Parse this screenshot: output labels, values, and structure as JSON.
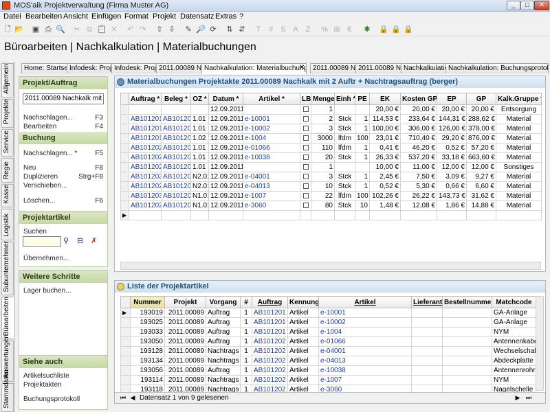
{
  "window": {
    "title": "MOS'aik Projektverwaltung (Firma Muster AG)",
    "minimize": "_",
    "maximize": "□",
    "close": "✕"
  },
  "menu": [
    "Datei",
    "Bearbeiten",
    "Ansicht",
    "Einfügen",
    "Format",
    "Projekt",
    "Datensatz",
    "Extras",
    "?"
  ],
  "toolbar_text": {
    "t": "T",
    "hash": "#",
    "s": "S",
    "a": "A",
    "z": "Z",
    "percent": "%"
  },
  "heading": "Büroarbeiten | Nachkalkulation | Materialbuchungen",
  "side_tabs": [
    "Allgemein",
    "Projekte",
    "Service",
    "Regie",
    "Kasse",
    "Logistik",
    "Subunternehmer",
    "Büroarbeiten",
    "Auswertungen",
    "Stammdaten"
  ],
  "doc_tabs": [
    "Home: Startseite",
    "Infodesk: Projekt",
    "Infodesk: Projekt",
    "2011.00089 Nachkalk",
    "Nachkalkulation: Materialbuchungen",
    "2011.00089 Nachk",
    "2011.00089 Nachk",
    "Nachkalkulation",
    "Nachkalkulation: Buchungsprotokoll"
  ],
  "left": {
    "projekt_head": "Projekt/Auftrag",
    "projekt_value": "2011.00089 Nachkalk mit 2 Au",
    "nachschlagen": "Nachschlagen...",
    "nachschlagen_key": "F3",
    "bearbeiten": "Bearbeiten",
    "bearbeiten_key": "F4",
    "buchung_head": "Buchung",
    "b_nachschlagen": "Nachschlagen... *",
    "b_nachschlagen_key": "F5",
    "neu": "Neu",
    "neu_key": "F8",
    "duplizieren": "Duplizieren",
    "duplizieren_key": "Strg+F8",
    "verschieben": "Verschieben...",
    "loeschen": "Löschen...",
    "loeschen_key": "F6",
    "artikel_head": "Projektartikel",
    "suchen": "Suchen",
    "uebernehmen": "Übernehmen...",
    "schritte_head": "Weitere Schritte",
    "lager": "Lager buchen...",
    "siehe_head": "Siehe auch",
    "artikelsuchliste": "Artikelsuchliste",
    "projektakten": "Projektakten",
    "buchungsprotokoll": "Buchungsprotokoll"
  },
  "buchungen": {
    "title": "Materialbuchungen Projektakte 2011.00089 Nachkalk mit 2 Auftr + Nachtragsauftrag (berger)",
    "columns": [
      "Auftrag *",
      "Beleg *",
      "OZ *",
      "Datum *",
      "Artikel *",
      "LB",
      "Menge",
      "Einh *",
      "PE",
      "EK",
      "Kosten GP",
      "EP",
      "GP",
      "Kalk.Gruppe *"
    ],
    "rows": [
      [
        "",
        "",
        "",
        "12.09.2011",
        "",
        "",
        "1",
        "",
        "",
        "20,00 €",
        "20,00 €",
        "20,00 €",
        "20,00 €",
        "Entsorgung"
      ],
      [
        "AB101201",
        "AB101201",
        "1.01",
        "12.09.2011",
        "e-10001",
        "",
        "2",
        "Stck",
        "1",
        "114,53 €",
        "233,64 €",
        "144,31 €",
        "288,62 €",
        "Material"
      ],
      [
        "AB101201",
        "AB101201",
        "1.01",
        "12.09.2011",
        "e-10002",
        "",
        "3",
        "Stck",
        "1",
        "100,00 €",
        "306,00 €",
        "126,00 €",
        "378,00 €",
        "Material"
      ],
      [
        "AB101201",
        "AB101201",
        "1.02",
        "12.09.2011",
        "e-1004",
        "",
        "3000",
        "lfdm",
        "100",
        "23,01 €",
        "710,40 €",
        "29,20 €",
        "876,00 €",
        "Material"
      ],
      [
        "AB101202",
        "AB101202",
        "1.01",
        "12.09.2011",
        "e-01066",
        "",
        "110",
        "lfdm",
        "1",
        "0,41 €",
        "46,20 €",
        "0,52 €",
        "57,20 €",
        "Material"
      ],
      [
        "AB101202",
        "AB101202",
        "1.01",
        "12.09.2011",
        "e-10038",
        "",
        "20",
        "Stck",
        "1",
        "26,33 €",
        "537,20 €",
        "33,18 €",
        "663,60 €",
        "Material"
      ],
      [
        "AB101202",
        "AB101202",
        "1.01",
        "12.09.2011",
        "",
        "",
        "1",
        "",
        "",
        "10,00 €",
        "11,00 €",
        "12,00 €",
        "12,00 €",
        "Sonstiges"
      ],
      [
        "AB101203",
        "AB101203",
        "N2.01",
        "12.09.2011",
        "e-04001",
        "",
        "3",
        "Stck",
        "1",
        "2,45 €",
        "7,50 €",
        "3,09 €",
        "9,27 €",
        "Material"
      ],
      [
        "AB101202",
        "AB101203",
        "N2.01",
        "12.09.2011",
        "e-04013",
        "",
        "10",
        "Stck",
        "1",
        "0,52 €",
        "5,30 €",
        "0,66 €",
        "6,60 €",
        "Material"
      ],
      [
        "AB101203",
        "AB101203",
        "N1.01",
        "12.09.2011",
        "e-1007",
        "",
        "22",
        "lfdm",
        "100",
        "102,26 €",
        "26,22 €",
        "143,73 €",
        "31,62 €",
        "Material"
      ],
      [
        "AB101202",
        "AB101203",
        "N1.01",
        "12.09.2011",
        "e-3060",
        "",
        "80",
        "Stck",
        "10",
        "1,48 €",
        "12,08 €",
        "1,86 €",
        "14,88 €",
        "Material"
      ]
    ]
  },
  "artikel": {
    "title": "Liste der Projektartikel",
    "columns": [
      "Nummer",
      "Projekt",
      "Vorgang",
      "#",
      "Auftrag",
      "Kennung",
      "Artikel",
      "Lieferant",
      "Bestellnummer",
      "Matchcode"
    ],
    "rows": [
      [
        "193019",
        "2011.00089",
        "Auftrag",
        "1",
        "AB101201",
        "Artikel",
        "e-10001",
        "",
        "",
        "GA-Anlage"
      ],
      [
        "193025",
        "2011.00089",
        "Auftrag",
        "1",
        "AB101201",
        "Artikel",
        "e-10002",
        "",
        "",
        "GA-Anlage"
      ],
      [
        "193033",
        "2011.00089",
        "Auftrag",
        "1",
        "AB101201",
        "Artikel",
        "e-1004",
        "",
        "",
        "NYM"
      ],
      [
        "193050",
        "2011.00089",
        "Auftrag",
        "1",
        "AB101202",
        "Artikel",
        "e-01066",
        "",
        "",
        "Antennenkabel"
      ],
      [
        "193128",
        "2011.00089",
        "Nachtrags",
        "1",
        "AB101202",
        "Artikel",
        "e-04001",
        "",
        "",
        "Wechselschalter"
      ],
      [
        "193134",
        "2011.00089",
        "Nachtrags",
        "1",
        "AB101202",
        "Artikel",
        "e-04013",
        "",
        "",
        "Abdeckplatte"
      ],
      [
        "193056",
        "2011.00089",
        "Auftrag",
        "1",
        "AB101202",
        "Artikel",
        "e-10038",
        "",
        "",
        "Antennenrohr"
      ],
      [
        "193114",
        "2011.00089",
        "Nachtrags",
        "1",
        "AB101202",
        "Artikel",
        "e-1007",
        "",
        "",
        "NYM"
      ],
      [
        "193118",
        "2011.00089",
        "Nachtrags",
        "1",
        "AB101202",
        "Artikel",
        "e-3060",
        "",
        "",
        "Nagelschelle"
      ]
    ],
    "status": "Datensatz 1 von 9 gelesenen"
  }
}
